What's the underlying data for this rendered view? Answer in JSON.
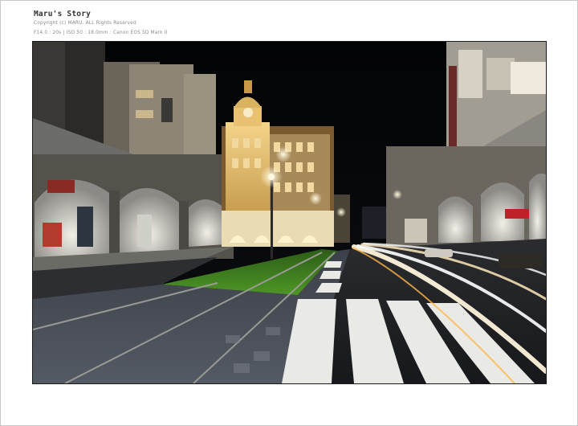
{
  "header": {
    "title": "Maru's Story",
    "copyright": "Copyright (c) MARU. ALL Rights Reserved",
    "exif": "F14.0 : 20s | ISO 50 : 18.0mm : Canon EOS 5D Mark II"
  },
  "photo": {
    "subject": "night-street-tram-tracks-light-trails",
    "colors": {
      "sky": "#050608",
      "grass": "#3f7f1e",
      "sidewalk": "#4a4e56",
      "asphalt": "#1e2024",
      "light_trail": "#fff4dc",
      "lamp": "#fff2c0"
    }
  }
}
